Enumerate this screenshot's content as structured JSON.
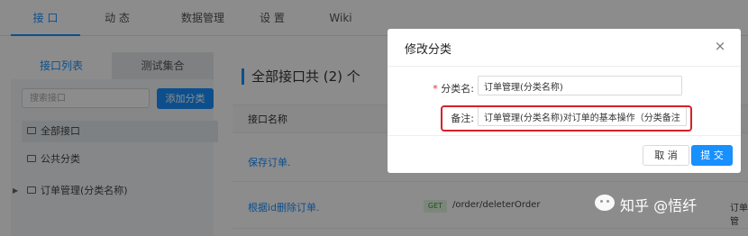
{
  "nav": {
    "tabs": [
      {
        "label": "接 口",
        "active": true
      },
      {
        "label": "动 态",
        "active": false
      },
      {
        "label": "数据管理",
        "active": false
      },
      {
        "label": "设 置",
        "active": false
      },
      {
        "label": "Wiki",
        "active": false
      }
    ]
  },
  "sidebar": {
    "tabs": [
      {
        "label": "接口列表",
        "active": true
      },
      {
        "label": "测试集合",
        "active": false
      }
    ],
    "search_placeholder": "搜索接口",
    "add_button": "添加分类",
    "items": [
      {
        "label": "全部接口",
        "selected": true
      },
      {
        "label": "公共分类",
        "selected": false
      },
      {
        "label": "订单管理(分类名称)",
        "selected": false,
        "expandable": true
      }
    ]
  },
  "content": {
    "title": "全部接口共 (2) 个",
    "column_name": "接口名称",
    "rows": [
      {
        "name": "保存订单.",
        "method": "",
        "path": ""
      },
      {
        "name": "根据id删除订单.",
        "method": "GET",
        "path": "/order/deleterOrder",
        "category_fragment": "订单管"
      }
    ]
  },
  "modal": {
    "title": "修改分类",
    "close_icon": "×",
    "fields": {
      "name_label": "分类名:",
      "name_required": "*",
      "name_value": "订单管理(分类名称)",
      "desc_label": "备注:",
      "desc_value": "订单管理(分类名称)对订单的基本操作（分类备注"
    },
    "cancel": "取 消",
    "submit": "提 交",
    "highlight_color": "#d6202a"
  },
  "watermark": {
    "text": "知乎 @悟纤"
  },
  "colors": {
    "accent": "#1890ff",
    "get_method": "#2d9a2d",
    "highlight": "#d6202a"
  }
}
